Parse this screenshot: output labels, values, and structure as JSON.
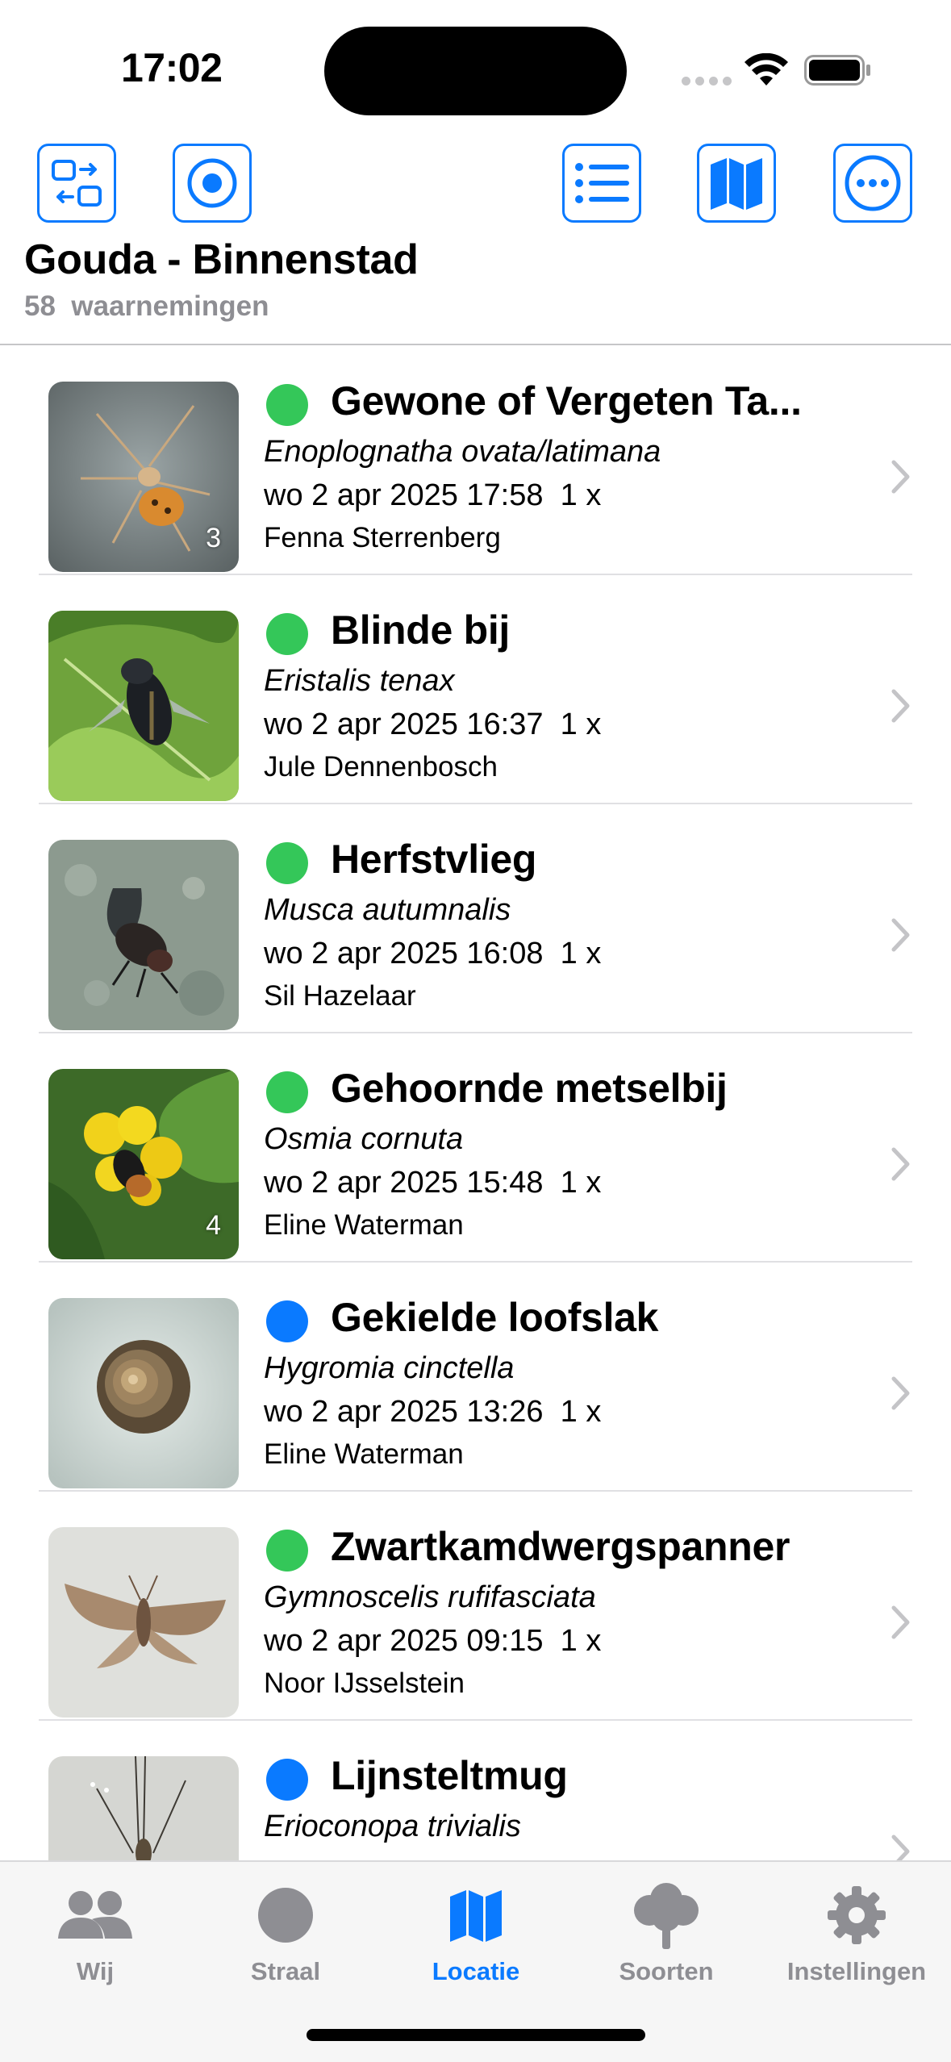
{
  "status_bar": {
    "time": "17:02"
  },
  "toolbar": {
    "buttons": [
      {
        "name": "swap-button",
        "icon": "swap-icon"
      },
      {
        "name": "locate-button",
        "icon": "target-icon"
      },
      {
        "name": "list-view-button",
        "icon": "list-icon"
      },
      {
        "name": "map-view-button",
        "icon": "map-icon"
      },
      {
        "name": "more-button",
        "icon": "ellipsis-icon"
      }
    ],
    "accent_color": "#0a7aff"
  },
  "header": {
    "title": "Gouda - Binnenstad",
    "count": "58",
    "count_label": "waarnemingen"
  },
  "status_colors": {
    "green": "#34c759",
    "blue": "#0a7aff"
  },
  "observations": [
    {
      "common_name": "Gewone of Vergeten Ta...",
      "scientific_name": "Enoplognatha ovata/latimana",
      "datetime": "wo 2 apr 2025 17:58",
      "count": "1 x",
      "observer": "Fenna Sterrenberg",
      "status": "green",
      "photo_count": "3",
      "photo_subject": "spider"
    },
    {
      "common_name": "Blinde bij",
      "scientific_name": "Eristalis tenax",
      "datetime": "wo 2 apr 2025 16:37",
      "count": "1 x",
      "observer": "Jule Dennenbosch",
      "status": "green",
      "photo_count": "",
      "photo_subject": "hoverfly-on-leaf"
    },
    {
      "common_name": "Herfstvlieg",
      "scientific_name": "Musca autumnalis",
      "datetime": "wo 2 apr 2025 16:08",
      "count": "1 x",
      "observer": "Sil Hazelaar",
      "status": "green",
      "photo_count": "",
      "photo_subject": "fly-on-stone"
    },
    {
      "common_name": "Gehoornde metselbij",
      "scientific_name": "Osmia cornuta",
      "datetime": "wo 2 apr 2025 15:48",
      "count": "1 x",
      "observer": "Eline Waterman",
      "status": "green",
      "photo_count": "4",
      "photo_subject": "bee-on-yellow-flower"
    },
    {
      "common_name": "Gekielde loofslak",
      "scientific_name": "Hygromia cinctella",
      "datetime": "wo 2 apr 2025 13:26",
      "count": "1 x",
      "observer": "Eline Waterman",
      "status": "blue",
      "photo_count": "",
      "photo_subject": "snail-shell"
    },
    {
      "common_name": "Zwartkamdwergspanner",
      "scientific_name": "Gymnoscelis rufifasciata",
      "datetime": "wo 2 apr 2025 09:15",
      "count": "1 x",
      "observer": "Noor IJsselstein",
      "status": "green",
      "photo_count": "",
      "photo_subject": "moth"
    },
    {
      "common_name": "Lijnsteltmug",
      "scientific_name": "Erioconopa trivialis",
      "datetime": "",
      "count": "",
      "observer": "",
      "status": "blue",
      "photo_count": "",
      "photo_subject": "cranefly"
    }
  ],
  "tabbar": {
    "tabs": [
      {
        "label": "Wij",
        "icon": "people-icon",
        "active": false
      },
      {
        "label": "Straal",
        "icon": "circle-icon",
        "active": false
      },
      {
        "label": "Locatie",
        "icon": "map-icon",
        "active": true
      },
      {
        "label": "Soorten",
        "icon": "tree-icon",
        "active": false
      },
      {
        "label": "Instellingen",
        "icon": "gear-icon",
        "active": false
      }
    ]
  }
}
